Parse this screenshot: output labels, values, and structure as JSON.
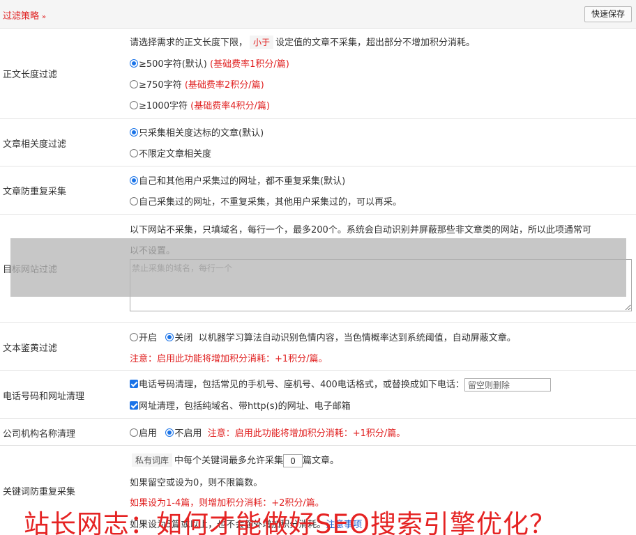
{
  "header": {
    "title": "过滤策略",
    "chevron_icon": "double-chevron-down-icon",
    "save_label": "快速保存"
  },
  "length_filter": {
    "label": "正文长度过滤",
    "desc_pre": "请选择需求的正文长度下限，",
    "desc_tag": "小于",
    "desc_post": "设定值的文章不采集，超出部分不增加积分消耗。",
    "options": [
      {
        "text": "≥500字符(默认)",
        "note": "(基础费率1积分/篇)",
        "selected": true
      },
      {
        "text": "≥750字符",
        "note": "(基础费率2积分/篇)",
        "selected": false
      },
      {
        "text": "≥1000字符",
        "note": "(基础费率4积分/篇)",
        "selected": false
      }
    ]
  },
  "relevance_filter": {
    "label": "文章相关度过滤",
    "options": [
      {
        "text": "只采集相关度达标的文章(默认)",
        "selected": true
      },
      {
        "text": "不限定文章相关度",
        "selected": false
      }
    ]
  },
  "duplicate_filter": {
    "label": "文章防重复采集",
    "options": [
      {
        "text": "自己和其他用户采集过的网址，都不重复采集(默认)",
        "selected": true
      },
      {
        "text": "自己采集过的网址，不重复采集，其他用户采集过的，可以再采。",
        "selected": false
      }
    ]
  },
  "site_filter": {
    "label": "目标网站过滤",
    "desc_line1": "以下网站不采集，只填域名，每行一个，最多200个。系统会自动识别并屏蔽那些非文章类的网站，所以此项通常可",
    "desc_line2": "以不设置。",
    "placeholder": "禁止采集的域名，每行一个"
  },
  "porn_filter": {
    "label": "文本鉴黄过滤",
    "option_on": "开启",
    "option_off": "关闭",
    "selected": "off",
    "desc": "以机器学习算法自动识别色情内容，当色情概率达到系统阈值，自动屏蔽文章。",
    "note": "注意：启用此功能将增加积分消耗：+1积分/篇。"
  },
  "contact_clean": {
    "label": "电话号码和网址清理",
    "phone_text": "电话号码清理，包括常见的手机号、座机号、400电话格式，或替换成如下电话：",
    "phone_placeholder": "留空则删除",
    "phone_checked": true,
    "url_text": "网址清理，包括纯域名、带http(s)的网址、电子邮箱",
    "url_checked": true
  },
  "org_clean": {
    "label": "公司机构名称清理",
    "option_on": "启用",
    "option_off": "不启用",
    "selected": "off",
    "note": "注意：启用此功能将增加积分消耗：+1积分/篇。"
  },
  "keyword_dup": {
    "label": "关键词防重复采集",
    "tag": "私有词库",
    "line1_mid": "中每个关键词最多允许采集",
    "count_value": "0",
    "line1_post": "篇文章。",
    "line2": "如果留空或设为0，则不限篇数。",
    "line3": "如果设为1-4篇，则增加积分消耗：+2积分/篇。",
    "line4_pre": "如果设为5篇或以上，也不会额外增加积分消耗。",
    "line4_link": "注意事项"
  },
  "watermark": "站长网志：如何才能做好SEO搜索引擎优化？",
  "colors": {
    "accent": "#e02020",
    "checked": "#1a73e8",
    "link": "#1a5fd0",
    "watermark": "#e52323"
  }
}
